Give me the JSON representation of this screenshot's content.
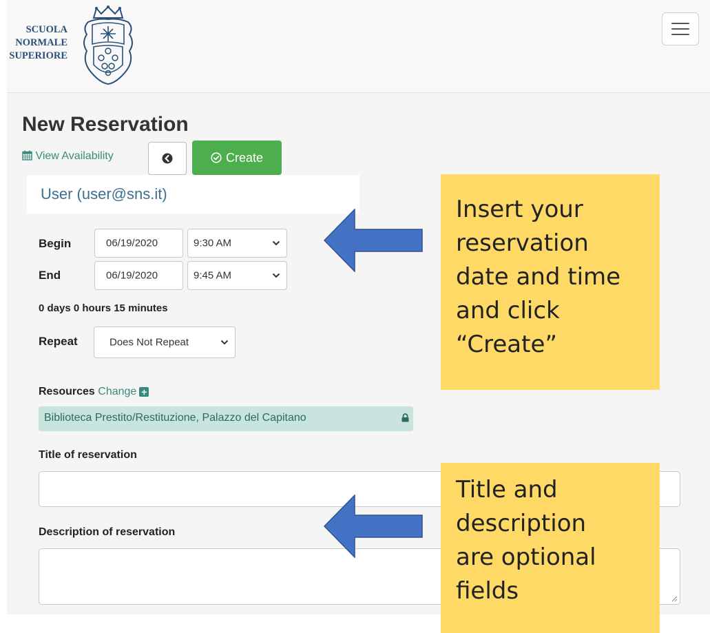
{
  "brand": {
    "line1": "SCUOLA",
    "line2": "NORMALE",
    "line3": "SUPERIORE"
  },
  "page": {
    "title": "New Reservation"
  },
  "toolbar": {
    "view_availability": "View Availability",
    "create_label": "Create"
  },
  "user": {
    "display": "User (user@sns.it)"
  },
  "schedule": {
    "begin_label": "Begin",
    "begin_date": "06/19/2020",
    "begin_time": "9:30 AM",
    "end_label": "End",
    "end_date": "06/19/2020",
    "end_time": "9:45 AM",
    "duration": "0 days 0 hours 15 minutes",
    "repeat_label": "Repeat",
    "repeat_value": "Does Not Repeat"
  },
  "resources": {
    "label": "Resources",
    "change_label": "Change",
    "selected": "Biblioteca Prestito/Restituzione, Palazzo del Capitano"
  },
  "form": {
    "title_label": "Title of reservation",
    "title_value": "",
    "description_label": "Description of reservation",
    "description_value": ""
  },
  "callouts": {
    "top": [
      "Insert your",
      "reservation",
      "date and time",
      "and click",
      "“Create”"
    ],
    "bottom": [
      "Title and",
      "description",
      "are optional",
      "fields"
    ]
  },
  "colors": {
    "accent": "#3a8a7a",
    "create_button": "#4cae4c",
    "callout": "#ffd966",
    "arrow": "#4472c4",
    "resource_tag": "#c9e3de"
  }
}
